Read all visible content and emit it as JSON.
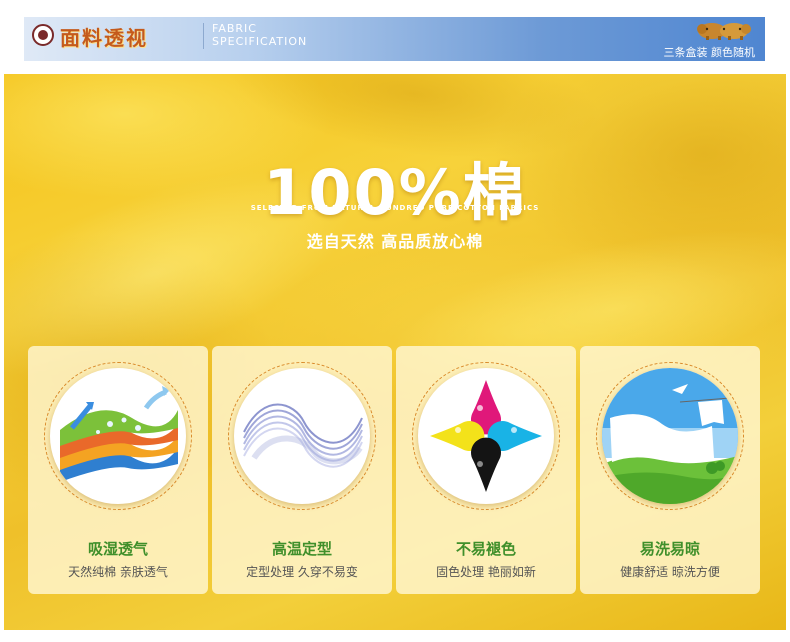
{
  "header": {
    "title": "面料透视",
    "subtitle_en_line1": "FABRIC",
    "subtitle_en_line2": "SPECIFICATION",
    "note": "三条盒装 颜色随机",
    "logo_icon": "elephant-logo-icon",
    "seal_icon": "round-seal-icon"
  },
  "hero": {
    "title": "100%棉",
    "subtitle_en": "SELECTED FROM NATURAL HUNDRED PURE COTTON FABRICS",
    "subtitle_cn": "选自天然 高品质放心棉"
  },
  "features": [
    {
      "title": "吸湿透气",
      "desc": "天然纯棉 亲肤透气",
      "icon": "layered-fabric-breathable-icon"
    },
    {
      "title": "高温定型",
      "desc": "定型处理 久穿不易变",
      "icon": "silk-wave-icon"
    },
    {
      "title": "不易褪色",
      "desc": "固色处理 艳丽如新",
      "icon": "cmyk-ink-drops-icon"
    },
    {
      "title": "易洗易晾",
      "desc": "健康舒适 晾洗方便",
      "icon": "laundry-drying-icon"
    }
  ],
  "colors": {
    "fabric_yellow": "#f4c31b",
    "feature_title_green": "#3f8f2a",
    "header_blue": "#4f86d1",
    "header_title_orange": "#c45a1c"
  }
}
